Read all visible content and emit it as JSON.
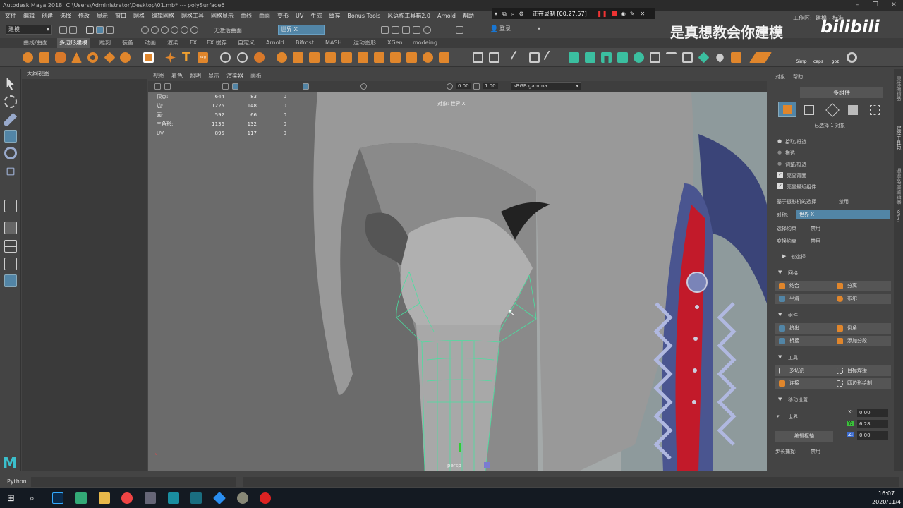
{
  "window": {
    "title": "Autodesk Maya 2018: C:\\Users\\Administrator\\Desktop\\01.mb*   ---   polySurface6",
    "minimize": "–",
    "restore": "❐",
    "close": "✕"
  },
  "menu": [
    "文件",
    "编辑",
    "创建",
    "选择",
    "修改",
    "显示",
    "窗口",
    "网格",
    "编辑网格",
    "网格工具",
    "网格显示",
    "曲线",
    "曲面",
    "变形",
    "UV",
    "生成",
    "缓存",
    "Bonus Tools",
    "风语栋工具箱2.0",
    "Arnold",
    "帮助"
  ],
  "status": {
    "mode_dropdown": "建模",
    "no_live_surface": "无激活曲面",
    "world_field": "世界 X",
    "login": "登录",
    "workspace_label": "工作区:",
    "workspace_value": "建模 - 标准"
  },
  "shelf_tabs": [
    "曲线/曲面",
    "多边形建模",
    "雕刻",
    "装备",
    "动画",
    "渲染",
    "FX",
    "FX 缓存",
    "自定义",
    "Arnold",
    "Bifrost",
    "MASH",
    "运动图形",
    "XGen",
    "modeing"
  ],
  "shelf_active_tab": "多边形建模",
  "shelf_right_icons": [
    "Simp",
    "caps",
    "goz"
  ],
  "recording": {
    "text": "正在录制 [00:27:57]"
  },
  "watermark": "是真想教会你建模",
  "logo": "bilibili",
  "outliner": {
    "title": "大纲视图"
  },
  "viewport": {
    "menu": [
      "视图",
      "着色",
      "照明",
      "显示",
      "渲染器",
      "面板"
    ],
    "exposure": "0.00",
    "gamma": "1.00",
    "color_space": "sRGB gamma",
    "object_label": "对象: 世界 X",
    "camera": "persp",
    "hud": [
      {
        "label": "顶点:",
        "a": "644",
        "b": "83",
        "c": "0"
      },
      {
        "label": "边:",
        "a": "1225",
        "b": "148",
        "c": "0"
      },
      {
        "label": "面:",
        "a": "592",
        "b": "66",
        "c": "0"
      },
      {
        "label": "三角形:",
        "a": "1136",
        "b": "132",
        "c": "0"
      },
      {
        "label": "UV:",
        "a": "895",
        "b": "117",
        "c": "0"
      }
    ]
  },
  "right_panel": {
    "tabs": [
      "对象",
      "帮助"
    ],
    "multi_component": "多组件",
    "selected_info": "已选择 1 对象",
    "pick_options": [
      "拾取/框选",
      "拖选",
      "调整/框选"
    ],
    "checkboxes": [
      "亮显背面",
      "亮显最近组件"
    ],
    "camera_based": "基于摄影机的选择",
    "disabled": "禁用",
    "symmetry_label": "对称:",
    "symmetry_value": "世界 X",
    "select_constraint": "选择约束",
    "transform_constraint": "变换约束",
    "soft_select": "软选择",
    "sections": {
      "mesh": "网格",
      "component": "组件",
      "tools": "工具",
      "move_settings": "移动设置"
    },
    "mesh_buttons": [
      "结合",
      "分离",
      "平滑",
      "布尔"
    ],
    "component_buttons": [
      "挤出",
      "倒角",
      "桥接",
      "添加分段"
    ],
    "tool_buttons": [
      "多切割",
      "目标焊接",
      "连接",
      "四边形绘制"
    ],
    "space": "世界",
    "edit_pivot": "编辑枢轴",
    "step_snap": "步长捕捉:",
    "step_snap_value": "禁用",
    "coords": {
      "x": "0.00",
      "y": "6.28",
      "z": "0.00"
    }
  },
  "side_tabs": [
    "建模工具包",
    "属性编辑器",
    "通道盒/层编辑器",
    "XGen"
  ],
  "cmdline": {
    "label": "Python"
  },
  "taskbar": {
    "time": "16:07",
    "date": "2020/11/4"
  },
  "colors": {
    "accent_blue": "#5285a6",
    "viewport_bg": "#6b6b6b",
    "wire_green": "#49e0a0"
  }
}
